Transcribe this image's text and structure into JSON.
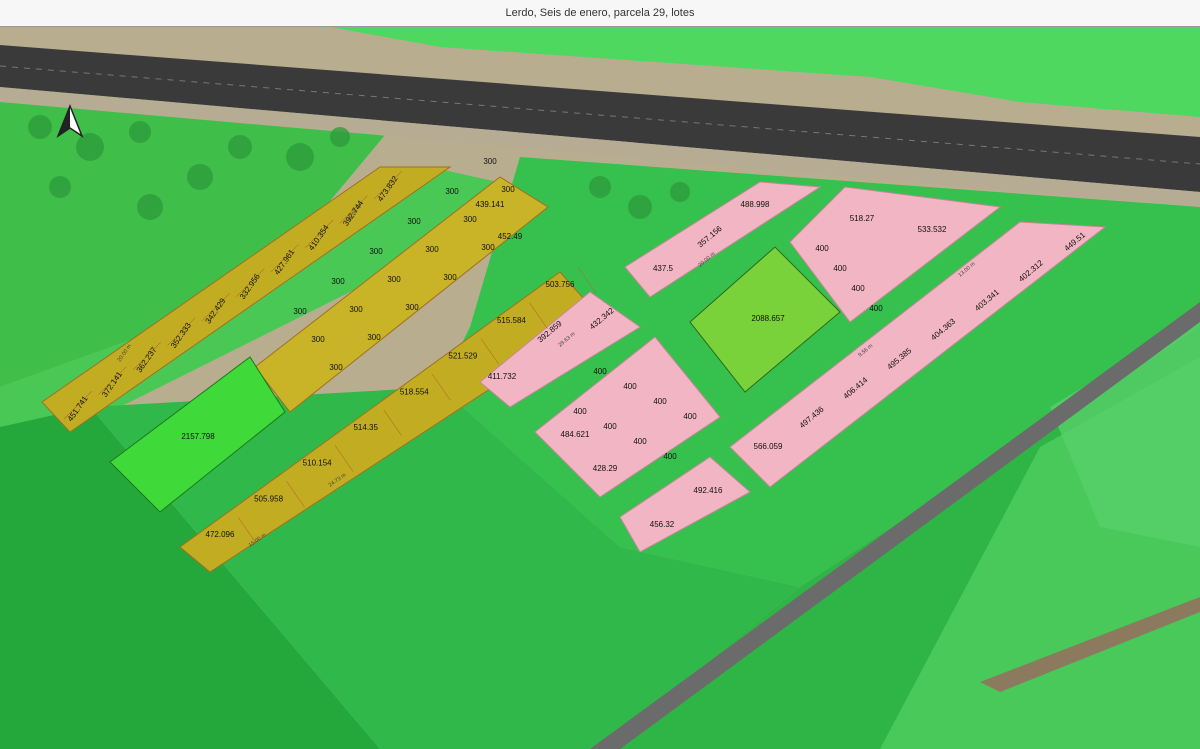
{
  "window": {
    "title": "Lerdo, Seis de enero, parcela 29, lotes"
  },
  "map": {
    "north_arrow": "north-arrow-icon",
    "colors": {
      "field_green": "#2ecc40",
      "dark_field": "#1f9a36",
      "yellow_lots": "#c8b42a",
      "pink_lots": "#f2b5c4",
      "lime_area": "#6cd43a",
      "bright_green_area": "#3fd93a",
      "road": "#3a3a3a"
    },
    "lots": {
      "north_row": [
        "473.832",
        "392.744",
        "410.354",
        "427.961",
        "332.956",
        "342.429",
        "352.333",
        "362.237",
        "372.141",
        "451.741"
      ],
      "yellow_300": [
        "300",
        "300",
        "300",
        "300",
        "300",
        "300",
        "300",
        "300",
        "300",
        "300",
        "300",
        "300",
        "300",
        "300",
        "300",
        "300",
        "300"
      ],
      "yellow_east": [
        "439.141",
        "452.49"
      ],
      "south_row": [
        "503.756",
        "515.584",
        "521.529",
        "518.554",
        "514.35",
        "510.154",
        "505.958",
        "472.096"
      ],
      "green_large": "2157.798",
      "pink_north": [
        "437.5",
        "357.156",
        "488.998"
      ],
      "pink_ne": [
        "518.27",
        "533.532"
      ],
      "pink_400_ne": [
        "400",
        "400",
        "400",
        "400"
      ],
      "pink_center": [
        "411.732",
        "392.859",
        "432.342"
      ],
      "pink_400_center": [
        "400",
        "400",
        "400",
        "400",
        "400",
        "400",
        "400",
        "400"
      ],
      "pink_sw": [
        "484.621",
        "428.29"
      ],
      "pink_s": [
        "456.32",
        "492.416"
      ],
      "pink_east": [
        "566.059",
        "497.436",
        "406.414",
        "495.385",
        "404.363",
        "403.341",
        "402.312",
        "449.51"
      ],
      "lime_area": "2088.657"
    },
    "dimension_samples": [
      "20.00 m",
      "15.00 m",
      "24.73 m",
      "29.63 m",
      "9.56 m",
      "13.00 m"
    ]
  }
}
